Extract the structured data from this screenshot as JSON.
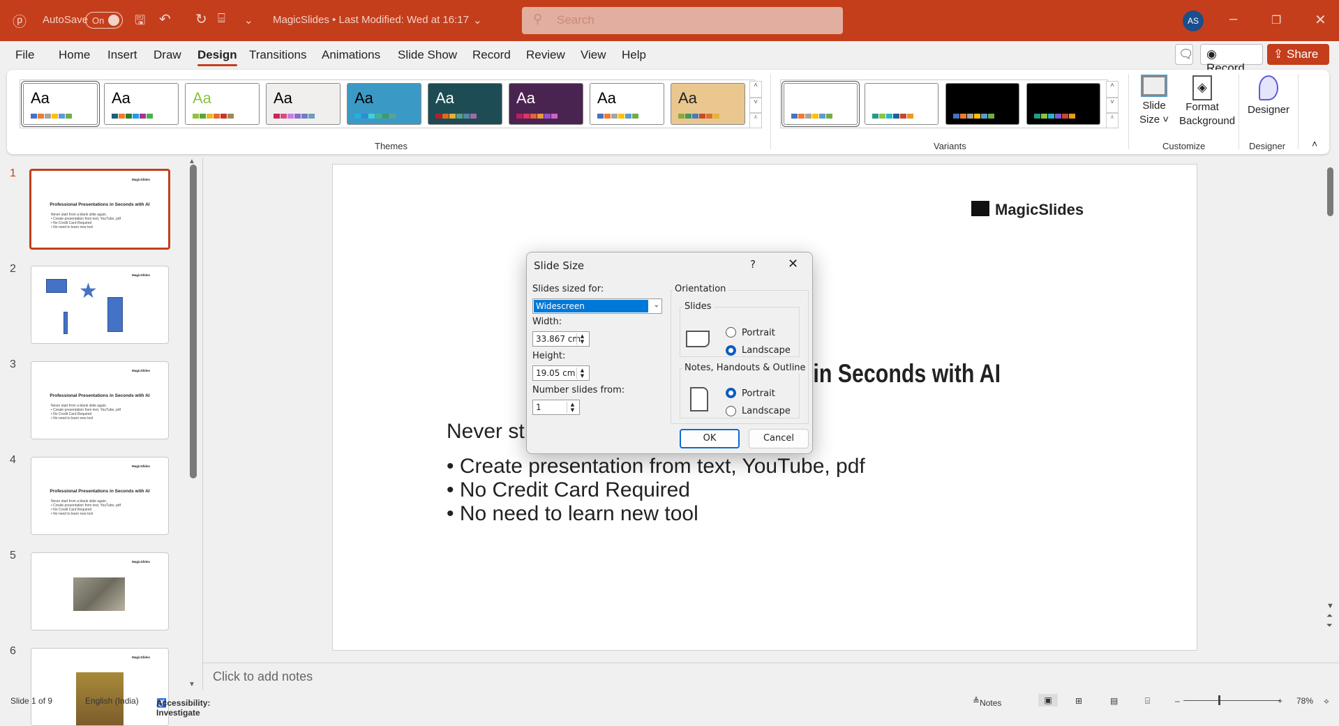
{
  "titlebar": {
    "autosave": "AutoSave",
    "toggle": "On",
    "doc_title": "MagicSlides • Last Modified: Wed at 16:17",
    "search_placeholder": "Search",
    "avatar": "AS"
  },
  "tabs": [
    "File",
    "Home",
    "Insert",
    "Draw",
    "Design",
    "Transitions",
    "Animations",
    "Slide Show",
    "Record",
    "Review",
    "View",
    "Help"
  ],
  "active_tab": "Design",
  "top_buttons": {
    "record": "Record",
    "share": "Share"
  },
  "ribbon": {
    "themes_label": "Themes",
    "variants_label": "Variants",
    "customize_label": "Customize",
    "designer_group_label": "Designer",
    "themes": [
      {
        "aa": "Aa",
        "bg": "#ffffff",
        "fg": "#000000",
        "swatches": [
          "#4472c4",
          "#ed7d31",
          "#a5a5a5",
          "#ffc000",
          "#5b9bd5",
          "#70ad47"
        ]
      },
      {
        "aa": "Aa",
        "bg": "#ffffff",
        "fg": "#000000",
        "swatches": [
          "#1f5f7a",
          "#ed7d31",
          "#2e7d32",
          "#1ba1e2",
          "#a83296",
          "#4caf50"
        ]
      },
      {
        "aa": "Aa",
        "bg": "#ffffff",
        "fg": "#8cc43f",
        "swatches": [
          "#93c13f",
          "#58a83a",
          "#e8b631",
          "#e56c2d",
          "#c9372c",
          "#9c8b57"
        ]
      },
      {
        "aa": "Aa",
        "bg": "#f1eeee",
        "fg": "#000000",
        "swatches": [
          "#c4285a",
          "#d04e86",
          "#c97ee6",
          "#8e6ccc",
          "#6f7fbf",
          "#6ba0b8"
        ]
      },
      {
        "aa": "Aa",
        "bg": "#3b9ac5",
        "fg": "#000000",
        "swatches": [
          "#1fb1e6",
          "#2c8ed1",
          "#3fcfd8",
          "#46b38f",
          "#3e9a6a",
          "#5aa19a"
        ]
      },
      {
        "aa": "Aa",
        "bg": "#1e4c54",
        "fg": "#ffffff",
        "swatches": [
          "#b52025",
          "#e0691c",
          "#e6b030",
          "#5a9c87",
          "#5387a8",
          "#a06aa8"
        ]
      },
      {
        "aa": "Aa",
        "bg": "#4a2450",
        "fg": "#ffffff",
        "swatches": [
          "#c21a5e",
          "#e0336b",
          "#e6613d",
          "#e89a3a",
          "#9c4ecf",
          "#c864c8"
        ]
      },
      {
        "aa": "Aa",
        "bg": "#ffffff",
        "fg": "#000000",
        "swatches": [
          "#4472c4",
          "#ed7d31",
          "#a5a5a5",
          "#ffc000",
          "#5b9bd5",
          "#70ad47"
        ]
      },
      {
        "aa": "Aa",
        "bg": "#e9c78f",
        "fg": "#222222",
        "swatches": [
          "#8ea83b",
          "#3f9a62",
          "#4a7ab8",
          "#c54c2b",
          "#d9722b",
          "#e6b23a"
        ]
      }
    ],
    "variants": [
      {
        "bg": "#ffffff",
        "swatches": [
          "#4472c4",
          "#ed7d31",
          "#a5a5a5",
          "#ffc000",
          "#5b9bd5",
          "#70ad47"
        ]
      },
      {
        "bg": "#ffffff",
        "swatches": [
          "#1f9e89",
          "#8cc43f",
          "#2ab5c9",
          "#1f5f9a",
          "#c9472c",
          "#e69a22"
        ]
      },
      {
        "bg": "#000000",
        "swatches": [
          "#4472c4",
          "#ed7d31",
          "#a5a5a5",
          "#ffc000",
          "#5b9bd5",
          "#70ad47"
        ]
      },
      {
        "bg": "#000000",
        "swatches": [
          "#1f9e89",
          "#8cc43f",
          "#2ab5c9",
          "#7a5ccc",
          "#c9472c",
          "#e69a22"
        ]
      }
    ],
    "slide_size": [
      "Slide",
      "Size"
    ],
    "format_background": [
      "Format",
      "Background"
    ],
    "designer": "Designer"
  },
  "slide": {
    "logo": "MagicSlides",
    "title": "Professional Presentations in Seconds with AI",
    "visible_title": "in Seconds with AI",
    "intro": "Never start from a blank slide again.",
    "visible_intro": "Never st",
    "bullets": [
      "• Create presentation from text, YouTube, pdf",
      "• No Credit Card Required",
      "• No need to learn new tool"
    ]
  },
  "thumbnails": [
    {
      "num": "1"
    },
    {
      "num": "2"
    },
    {
      "num": "3"
    },
    {
      "num": "4"
    },
    {
      "num": "5"
    },
    {
      "num": "6"
    }
  ],
  "notes_placeholder": "Click to add notes",
  "status": {
    "slide": "Slide 1 of 9",
    "language": "English (India)",
    "accessibility": "Accessibility: Investigate",
    "notes": "Notes",
    "zoom": "78%"
  },
  "dialog": {
    "title": "Slide Size",
    "help": "?",
    "sized_for_label": "Slides sized for:",
    "sized_for_value": "Widescreen",
    "width_label": "Width:",
    "width_value": "33.867 cm",
    "height_label": "Height:",
    "height_value": "19.05 cm",
    "number_label": "Number slides from:",
    "number_value": "1",
    "orientation_label": "Orientation",
    "slides_label": "Slides",
    "notes_label": "Notes, Handouts & Outline",
    "portrait": "Portrait",
    "landscape": "Landscape",
    "ok": "OK",
    "cancel": "Cancel"
  }
}
